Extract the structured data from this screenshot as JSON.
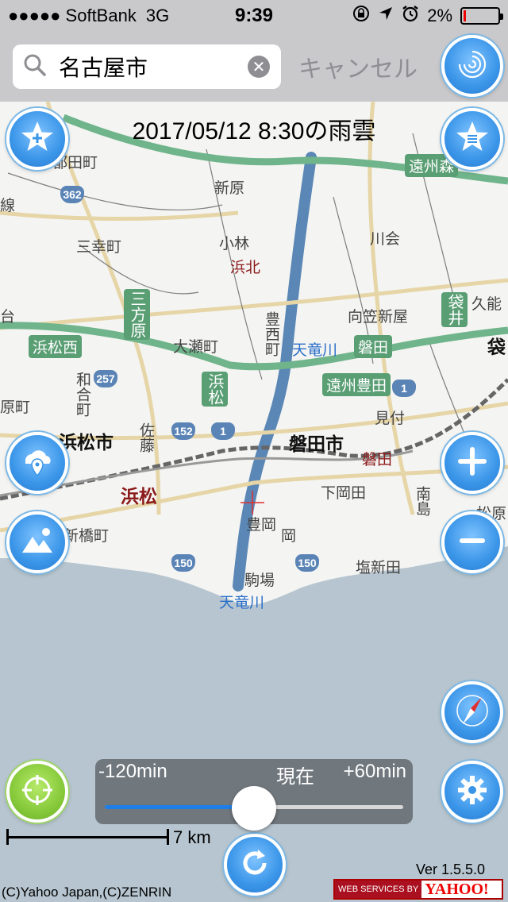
{
  "status_bar": {
    "carrier": "●●●●● SoftBank",
    "network": "3G",
    "time": "9:39",
    "battery": "2%"
  },
  "search": {
    "value": "名古屋市",
    "placeholder": "",
    "cancel_label": "キャンセル"
  },
  "map": {
    "title": "2017/05/12 8:30の雨雲",
    "labels": {
      "kami_nishi": "台",
      "hamamatsu_nishi": "浜松西",
      "hamamatsu_city": "浜松市",
      "hamamatsu_station": "浜松",
      "shinbashi": "新橋町",
      "miyuki": "三幸町",
      "tsuda": "都田町",
      "shinhara": "新原",
      "kobayashi": "小林",
      "hamakita": "浜北",
      "mikatahara": "三方原",
      "ooze": "大瀬町",
      "toyonishi": "豊西町",
      "tenryugawa": "天竜川",
      "tenryugawa2": "天竜川",
      "iwata": "磐田",
      "iwata_city": "磐田市",
      "iwata_station": "磐田",
      "ensyu_toyoda": "遠州豊田",
      "ensyu_mori": "遠州森",
      "kawai": "川会",
      "mukasa": "向笠新屋",
      "fukuroi": "袋井",
      "kunou": "久能",
      "fukuro": "袋",
      "mitsuke": "見付",
      "shimookada": "下岡田",
      "minamijima": "南島",
      "matsubara": "松原",
      "toyooka": "豊岡",
      "oka": "岡",
      "komaba": "駒場",
      "shionishinden": "塩新田",
      "sato": "佐藤",
      "hara": "原町",
      "wagou": "和合町",
      "hamamatsu_road": "浜松",
      "sen": "線",
      "route_362": "362",
      "route_257": "257",
      "route_152": "152",
      "route_1a": "1",
      "route_1b": "1",
      "route_150a": "150",
      "route_150b": "150"
    }
  },
  "slider": {
    "left_label": "-120min",
    "now_label": "現在",
    "right_label": "+60min",
    "range_min": -120,
    "range_max": 60,
    "value": -30
  },
  "scale": {
    "label": "7 km"
  },
  "footer": {
    "version": "Ver 1.5.5.0",
    "copyright": "(C)Yahoo Japan,(C)ZENRIN",
    "ws_label": "WEB SERVICES BY",
    "yahoo_label": "YAHOO!"
  },
  "buttons": {
    "rain_radar_icon": "spiral-icon",
    "add_favorite_icon": "star-plus-icon",
    "favorites_list_icon": "star-list-icon",
    "location_icon": "cloud-pin-icon",
    "landscape_icon": "mountain-sun-icon",
    "zoom_in_icon": "plus-icon",
    "zoom_out_icon": "minus-icon",
    "compass_icon": "compass-icon",
    "settings_icon": "gear-icon",
    "current_location_icon": "crosshair-icon",
    "refresh_icon": "refresh-icon"
  },
  "colors": {
    "accent_blue": "#3a95e8",
    "accent_green": "#86c93a",
    "sea": "#b6c5cf",
    "highway": "#6fb48a"
  }
}
